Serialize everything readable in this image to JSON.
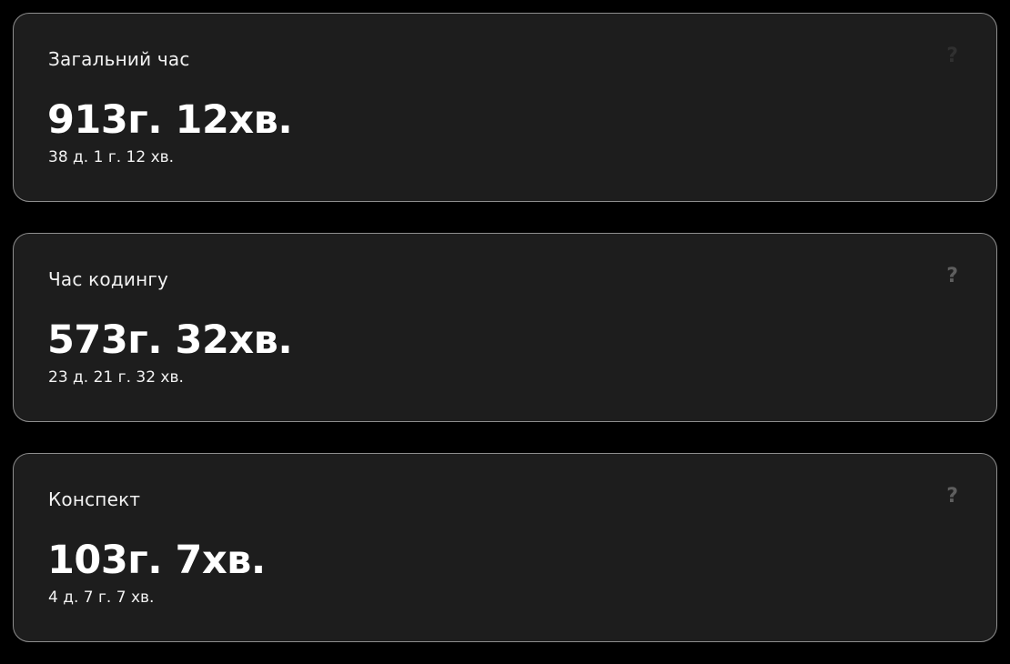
{
  "cards": [
    {
      "title": "Загальний час",
      "value": "913г. 12хв.",
      "detail": "38 д. 1 г. 12 хв.",
      "help_icon": "question-mark-icon",
      "help_color": "#303030"
    },
    {
      "title": "Час кодингу",
      "value": "573г. 32хв.",
      "detail": "23 д. 21 г. 32 хв.",
      "help_icon": "question-mark-icon",
      "help_color": "#5e5e5e"
    },
    {
      "title": "Конспект",
      "value": "103г. 7хв.",
      "detail": "4 д. 7 г. 7 хв.",
      "help_icon": "question-mark-icon",
      "help_color": "#5e5e5e"
    }
  ],
  "colors": {
    "background": "#000000",
    "card_background": "#1d1d1d",
    "card_border": "#8e8e8e",
    "text": "#ffffff"
  }
}
